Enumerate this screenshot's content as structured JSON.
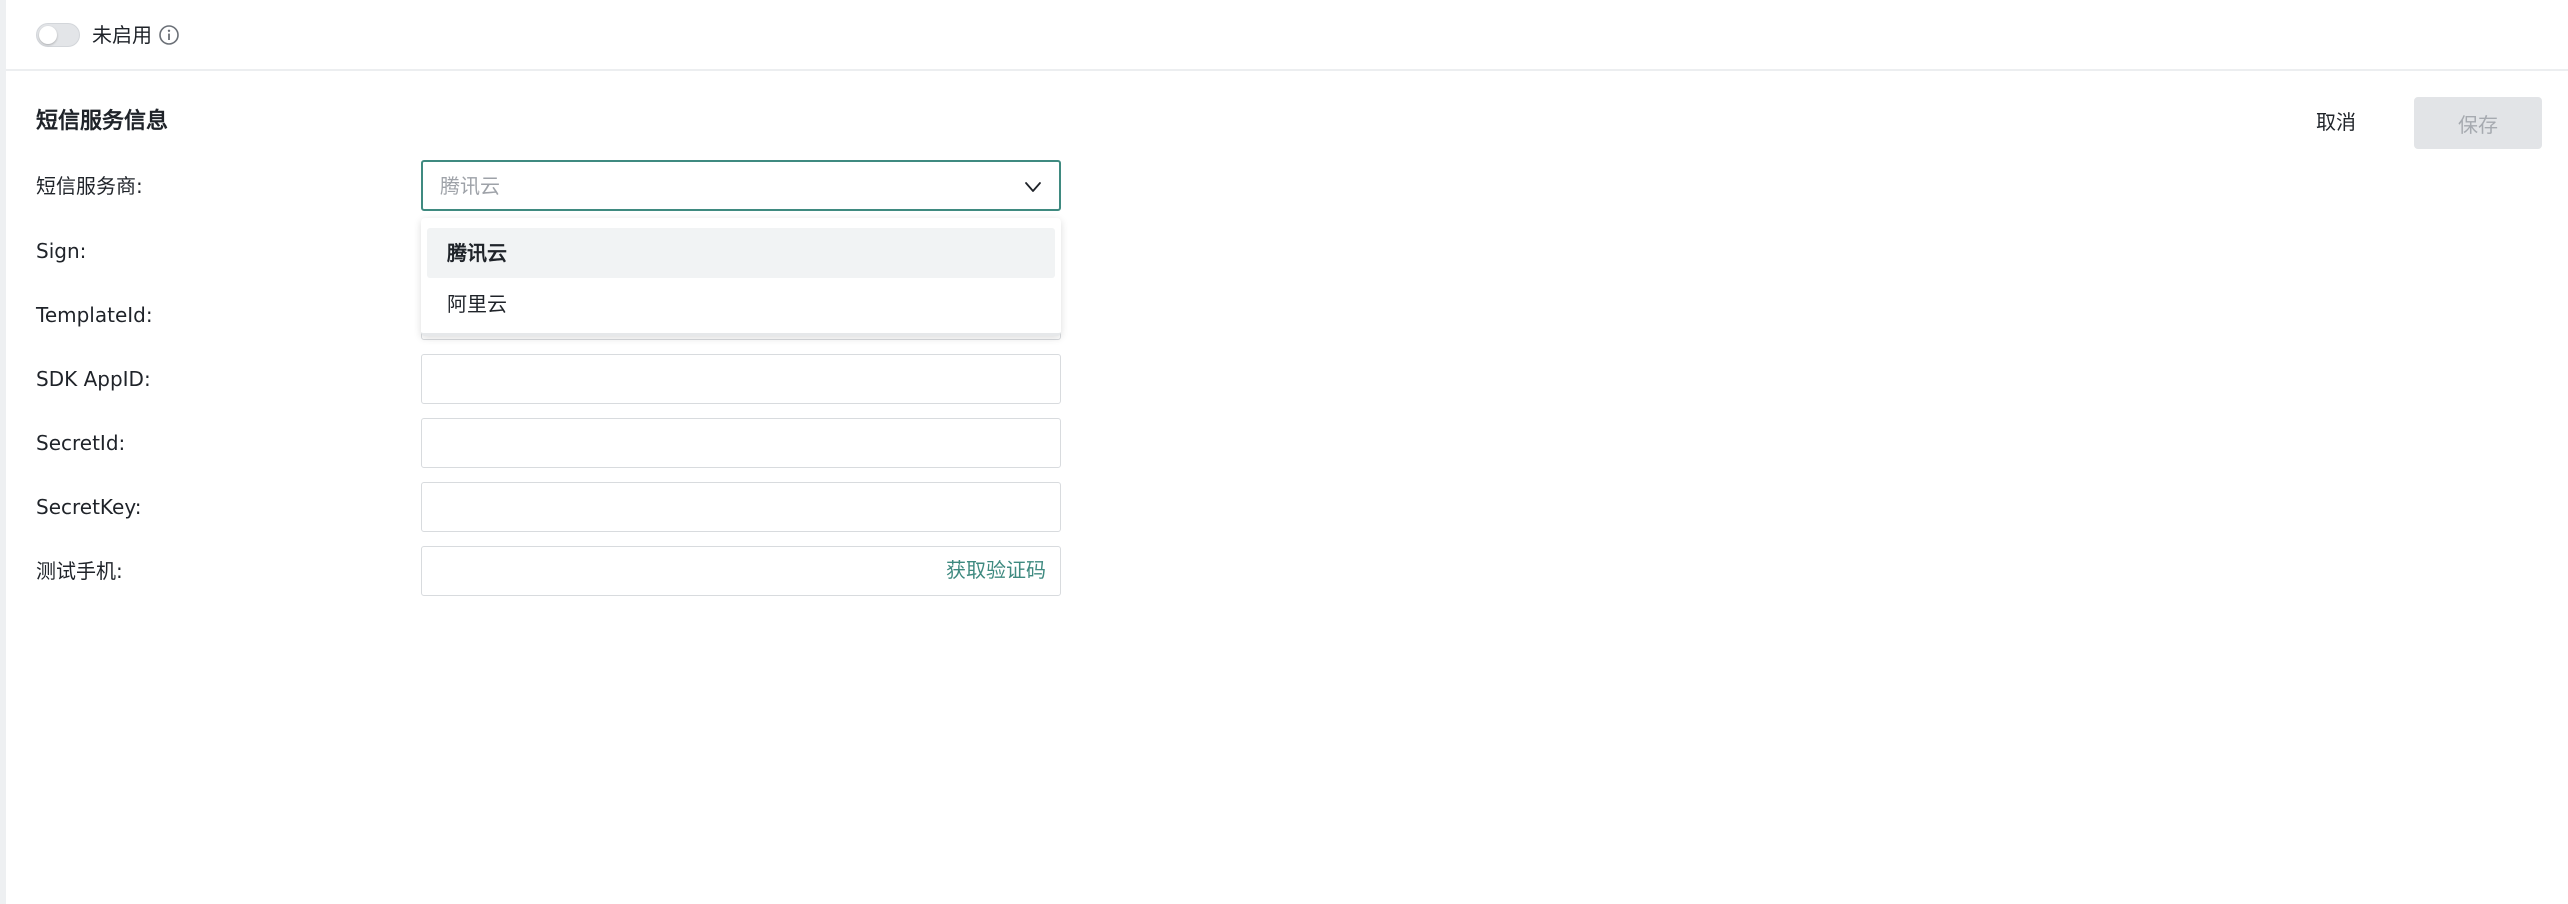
{
  "status": {
    "toggle_label": "未启用",
    "enabled": false
  },
  "section": {
    "title": "短信服务信息",
    "cancel_label": "取消",
    "save_label": "保存"
  },
  "form": {
    "provider": {
      "label": "短信服务商:",
      "value": "腾讯云",
      "options": [
        "腾讯云",
        "阿里云"
      ],
      "selected_index": 0
    },
    "sign": {
      "label": "Sign:",
      "value": ""
    },
    "template_id": {
      "label": "TemplateId:",
      "value": ""
    },
    "sdk_appid": {
      "label": "SDK AppID:",
      "value": ""
    },
    "secret_id": {
      "label": "SecretId:",
      "value": ""
    },
    "secret_key": {
      "label": "SecretKey:",
      "value": ""
    },
    "test_phone": {
      "label": "测试手机:",
      "value": "",
      "action_label": "获取验证码"
    }
  },
  "colors": {
    "accent": "#3f8a80",
    "save_disabled_bg": "#e2e4e7",
    "save_disabled_text": "#a6aab0"
  },
  "icons": {
    "toggle_info": "info-icon",
    "select": "chevron-down-icon"
  }
}
